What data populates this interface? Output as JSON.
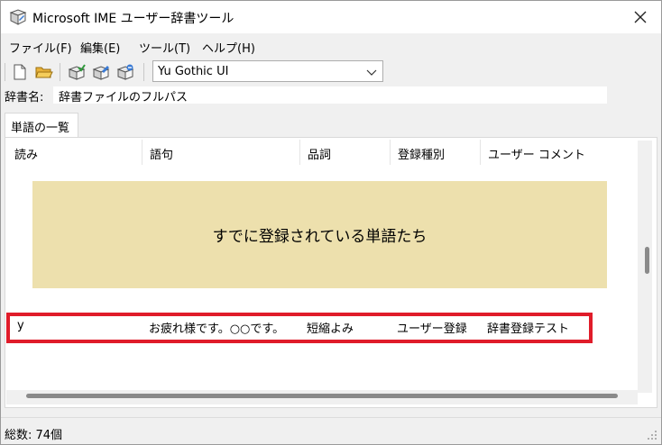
{
  "window": {
    "title": "Microsoft IME ユーザー辞書ツール"
  },
  "menu": {
    "file": "ファイル(F)",
    "edit": "編集(E)",
    "tools": "ツール(T)",
    "help": "ヘルプ(H)"
  },
  "toolbar": {
    "font": "Yu Gothic UI",
    "icons": [
      "new-file-icon",
      "open-folder-icon",
      "add-word-icon",
      "edit-word-icon",
      "delete-word-icon"
    ]
  },
  "dictionary": {
    "label": "辞書名:",
    "path": "辞書ファイルのフルパス"
  },
  "tab": {
    "label": "単語の一覧"
  },
  "columns": [
    "読み",
    "語句",
    "品詞",
    "登録種別",
    "ユーザー コメント"
  ],
  "overlay_text": "すでに登録されている単語たち",
  "row": {
    "reading": "y",
    "phrase": "お疲れ様です。○○です。",
    "pos": "短縮よみ",
    "type": "ユーザー登録",
    "comment": "辞書登録テスト"
  },
  "status": {
    "text": "総数: 74個"
  },
  "colors": {
    "highlight": "#e01c2a",
    "overlay": "#ede0ad"
  }
}
